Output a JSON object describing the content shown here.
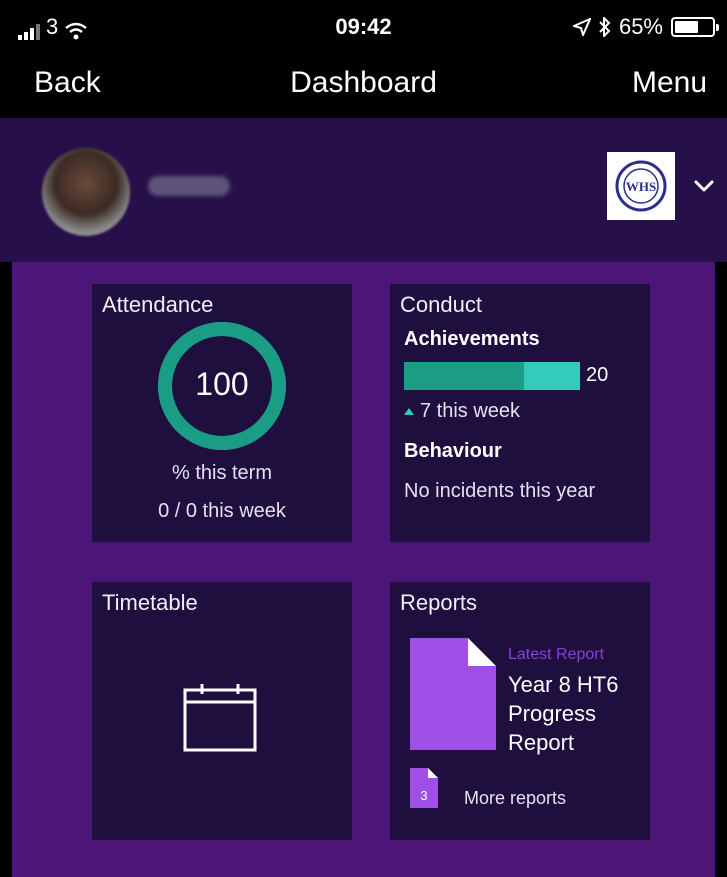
{
  "status_bar": {
    "carrier": "3",
    "time": "09:42",
    "battery": "65%",
    "battery_level": 0.65,
    "icons": [
      "signal-icon",
      "wifi-icon",
      "location-icon",
      "bluetooth-icon",
      "battery-icon"
    ]
  },
  "nav": {
    "back_label": "Back",
    "title": "Dashboard",
    "menu_label": "Menu"
  },
  "profile": {
    "name": "•••••",
    "logo_text": "WHS"
  },
  "attendance": {
    "title": "Attendance",
    "value": "100",
    "percent": 100,
    "term_label": "% this term",
    "week_label": "0 / 0 this week"
  },
  "conduct": {
    "title": "Conduct",
    "achievements_label": "Achievements",
    "achievements_count": "20",
    "achievements_week": "7 this week",
    "behaviour_label": "Behaviour",
    "behaviour_text": "No incidents this year"
  },
  "timetable": {
    "title": "Timetable"
  },
  "reports": {
    "title": "Reports",
    "latest_label": "Latest Report",
    "latest_title": "Year 8 HT6 Progress Report",
    "more_count": "3",
    "more_label": "More reports"
  },
  "colors": {
    "background": "#000000",
    "profile_band": "#27104a",
    "main_bg": "#4b1678",
    "card_bg": "#1e0f3f",
    "ring": "#1b9c84",
    "bar_teal": "#33ccba",
    "accent_purple": "#a04fe6"
  }
}
